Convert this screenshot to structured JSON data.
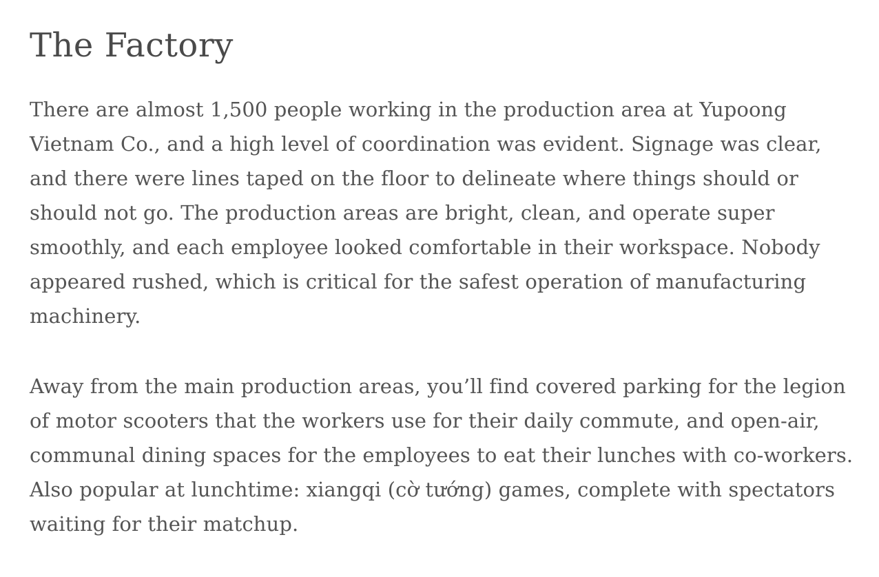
{
  "article": {
    "title": "The Factory",
    "paragraphs": [
      "There are almost 1,500 people working in the production area at Yupoong Vietnam Co., and a high level of coordination was evident. Signage was clear, and there were lines taped on the floor to delineate where things should or should not go. The production areas are bright, clean, and operate super smoothly, and each employee looked comfortable in their workspace. Nobody appeared rushed, which is critical for the safest operation of manufacturing machinery.",
      "Away from the main production areas, you’ll find covered parking for the legion of motor scooters that the workers use for their daily commute, and open-air, communal dining spaces for the employees to eat their lunches with co-workers. Also popular at lunchtime: xiangqi (cờ tướng) games, complete with spectators waiting for their matchup."
    ]
  },
  "colors": {
    "text": "#555555",
    "heading": "#4a4a4a",
    "background": "#ffffff"
  }
}
